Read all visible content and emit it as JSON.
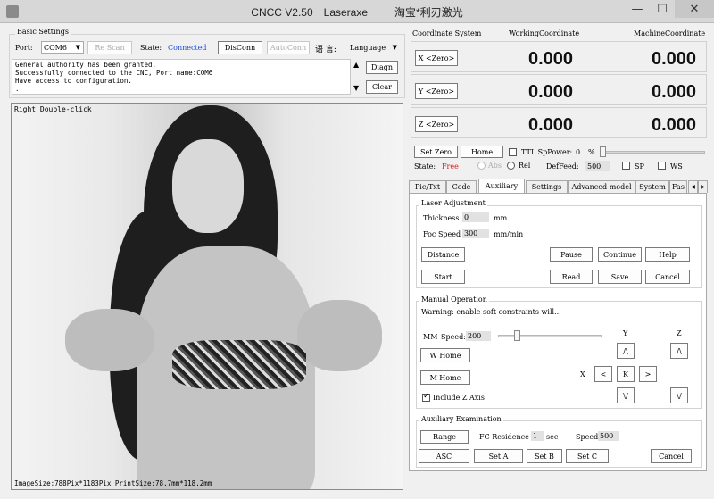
{
  "window": {
    "title_name": "CNCC V2.50",
    "title_brand": "Laseraxe",
    "title_shop": "淘宝*利刃激光",
    "minimize": "—",
    "maximize": "☐",
    "close": "✕"
  },
  "basic": {
    "group_label": "Basic Settings",
    "port_label": "Port:",
    "port_value": "COM6",
    "rescan": "Re Scan",
    "state_label": "State:",
    "state_value": "Connected",
    "disconn": "DisConn",
    "autoconn": "AutoConn",
    "lang_glyph": "语 言:",
    "lang_value": "Language",
    "log_lines": [
      "General authority has been granted.",
      "Successfully connected to the CNC, Port name:COM6",
      "Have access to configuration.",
      "."
    ],
    "diagn": "Diagn",
    "clear": "Clear"
  },
  "image": {
    "caption": "Right Double-click",
    "footer": "ImageSize:788Pix*1183Pix  PrintSize:78.7mm*118.2mm"
  },
  "coords": {
    "system_label": "Coordinate System",
    "working_label": "WorkingCoordinate",
    "machine_label": "MachineCoordinate",
    "rows": [
      {
        "button": "X <Zero>",
        "working": "0.000",
        "machine": "0.000"
      },
      {
        "button": "Y <Zero>",
        "working": "0.000",
        "machine": "0.000"
      },
      {
        "button": "Z <Zero>",
        "working": "0.000",
        "machine": "0.000"
      }
    ]
  },
  "controls": {
    "set_zero": "Set Zero",
    "home": "Home",
    "ttl_label": "TTL SpPower:",
    "ttl_value": "0",
    "ttl_unit": "%",
    "state_label": "State:",
    "state_value": "Free",
    "abs_label": "Abs",
    "rel_label": "Rel",
    "deffeed_label": "DefFeed:",
    "deffeed_value": "500",
    "sp_label": "SP",
    "ws_label": "WS"
  },
  "tabs": [
    "Pic/Txt",
    "Code",
    "Auxiliary",
    "Settings",
    "Advanced model",
    "System",
    "Fas"
  ],
  "laser": {
    "group_label": "Laser Adjustment",
    "thickness_label": "Thickness",
    "thickness_value": "0",
    "thickness_unit": "mm",
    "foc_label": "Foc Speed",
    "foc_value": "300",
    "foc_unit": "mm/min",
    "distance": "Distance",
    "pause": "Pause",
    "continue": "Continue",
    "help": "Help",
    "start": "Start",
    "read": "Read",
    "save": "Save",
    "cancel": "Cancel"
  },
  "manual": {
    "group_label": "Manual Operation",
    "warning": "Warning: enable soft constraints will...",
    "mm_label": "MM",
    "speed_label": "Speed:",
    "speed_value": "200",
    "w_home": "W Home",
    "m_home": "M Home",
    "include_z": "Include Z Axis",
    "axis_y": "Y",
    "axis_z": "Z",
    "axis_x": "X",
    "up": "/\\",
    "down": "\\/",
    "left": "<",
    "right": ">",
    "center": "K"
  },
  "aux": {
    "group_label": "Auxiliary Examination",
    "range": "Range",
    "fc_label": "FC Residence",
    "fc_value": "1",
    "fc_unit": "sec",
    "speed_label": "Speed",
    "speed_value": "500",
    "asc": "ASC",
    "set_a": "Set A",
    "set_b": "Set B",
    "set_c": "Set C",
    "cancel": "Cancel"
  },
  "colors": {
    "connected": "#1a4fd6",
    "free": "#d42020"
  }
}
